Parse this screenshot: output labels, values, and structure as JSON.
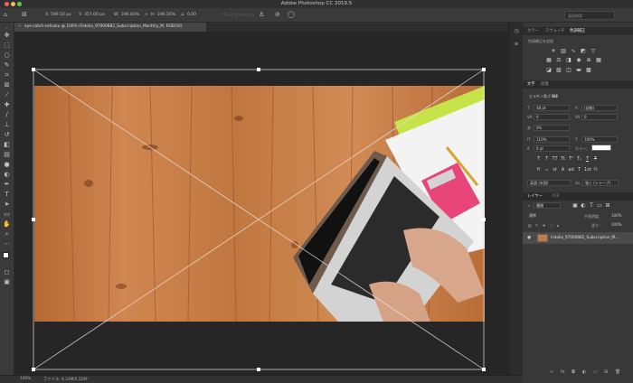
{
  "titlebar": {
    "title": "Adobe Photoshop CC 2019.5"
  },
  "options": {
    "x_label": "X:",
    "x_value": "599.50 px",
    "y_label": "Y:",
    "y_value": "357.00 px",
    "w_label": "W:",
    "w_value": "296.60%",
    "h_label": "H:",
    "h_value": "296.56%",
    "angle_value": "0.00",
    "mode_label": "ワープとメッシュ",
    "search_placeholder": "画面検索"
  },
  "document": {
    "tab_title": "eye-catch-setsuku @ 100% (Fotolia_97000882_Subscription_Monthly_M, RGB/16)"
  },
  "status": {
    "zoom": "100%",
    "file_info": "ファイル: 4.33M/5.51M"
  },
  "panel_color": {
    "tabs": [
      "カラー",
      "スウォッチ",
      "色調補正"
    ],
    "active_tab_index": 2,
    "subtitle": "色調補正を追加"
  },
  "panel_char": {
    "tabs": [
      "文字",
      "段落"
    ],
    "font_family": "ヒラギノ角ゴ Std",
    "font_style": "W4",
    "font_size": "48 pt",
    "leading": "(自動)",
    "kerning": "0",
    "tracking": "0",
    "tsume": "0%",
    "vscale": "110%",
    "hscale": "100%",
    "baseline": "0 pt",
    "color_label": "カラー:",
    "language": "英語 (米国)",
    "antialias": "強く (シャープ)"
  },
  "panel_layers": {
    "tabs": [
      "レイヤー",
      "パス"
    ],
    "kind_label": "種類",
    "blend_mode": "通常",
    "opacity_label": "不透明度:",
    "opacity_value": "100%",
    "fill_label": "塗り:",
    "fill_value": "100%",
    "layer_name": "Fotolia_97000882_Subscription_M..."
  },
  "colors": {
    "accent": "#31a8ff",
    "panel_bg": "#383838",
    "canvas_bg": "#262626"
  }
}
